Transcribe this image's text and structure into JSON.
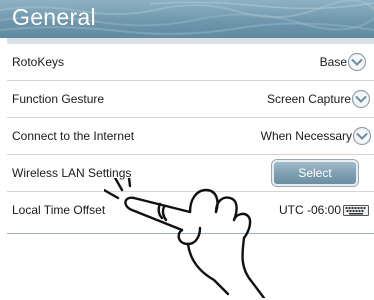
{
  "header": {
    "title": "General"
  },
  "settings": [
    {
      "label": "RotoKeys",
      "value": "Base",
      "control": "chevron-down-icon"
    },
    {
      "label": "Function Gesture",
      "value": "Screen Capture",
      "control": "chevron-down-icon"
    },
    {
      "label": "Connect to the Internet",
      "value": "When Necessary",
      "control": "chevron-down-icon"
    },
    {
      "label": "Wireless LAN Settings",
      "button": "Select"
    },
    {
      "label": "Local Time Offset",
      "value": "UTC -06:00",
      "control": "keyboard-icon"
    }
  ],
  "illustration": {
    "icon": "tap-gesture-hand-icon"
  },
  "colors": {
    "header": "#6f97ad",
    "button": "#7fa0b3",
    "text": "#1a1a1a",
    "divider": "#d5d5d5"
  }
}
